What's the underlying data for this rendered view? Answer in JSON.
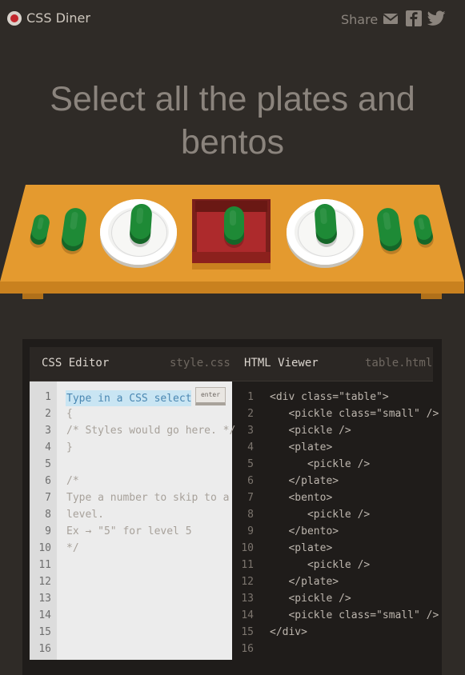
{
  "header": {
    "brand": "CSS Diner",
    "share_label": "Share",
    "icons": [
      "mail-icon",
      "facebook-icon",
      "twitter-icon"
    ]
  },
  "level": {
    "title": "Select all the plates and bentos"
  },
  "table_items": [
    "small-pickle",
    "pickle",
    "plate-with-pickle",
    "bento-with-pickle",
    "plate-with-pickle",
    "pickle",
    "small-pickle"
  ],
  "editor": {
    "css_title": "CSS Editor",
    "css_file": "style.css",
    "html_title": "HTML Viewer",
    "html_file": "table.html",
    "input_placeholder": "Type in a CSS selector",
    "enter_label": "enter",
    "css_lines": [
      "",
      "{",
      "/* Styles would go here. */",
      "}",
      "",
      "/*",
      "Type a number to skip to a",
      "level.",
      "Ex → \"5\" for level 5",
      "*/",
      "",
      "",
      "",
      "",
      "",
      ""
    ],
    "html_lines": [
      "<div class=\"table\">",
      "   <pickle class=\"small\" />",
      "   <pickle />",
      "   <plate>",
      "      <pickle />",
      "   </plate>",
      "   <bento>",
      "      <pickle />",
      "   </bento>",
      "   <plate>",
      "      <pickle />",
      "   </plate>",
      "   <pickle />",
      "   <pickle class=\"small\" />",
      "</div>",
      ""
    ],
    "line_numbers": [
      "1",
      "2",
      "3",
      "4",
      "5",
      "6",
      "7",
      "8",
      "9",
      "10",
      "11",
      "12",
      "13",
      "14",
      "15",
      "16"
    ]
  },
  "colors": {
    "background": "#2f2b27",
    "table": "#e49a2f",
    "pickle": "#1e8a36",
    "bento": "#ad2a2c",
    "input_highlight": "#c9e5f3"
  }
}
